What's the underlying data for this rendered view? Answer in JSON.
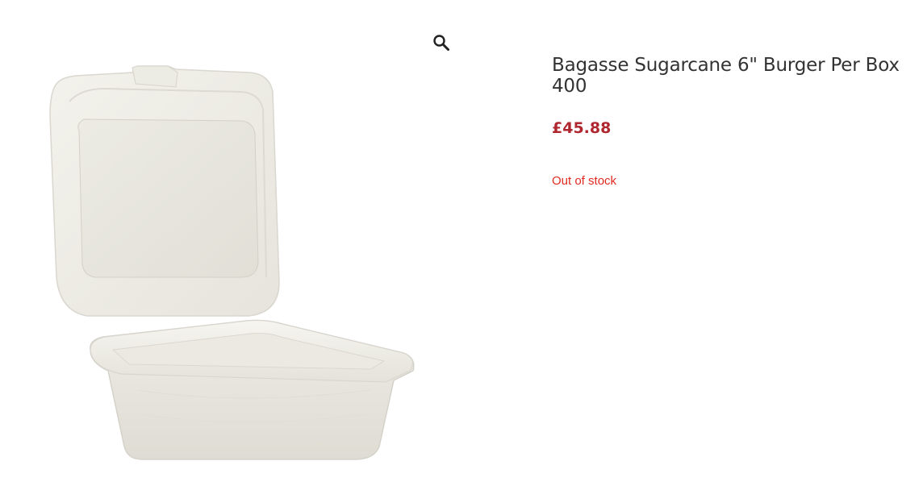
{
  "product": {
    "title": "Bagasse Sugarcane 6\" Burger Per Box 400",
    "price": "£45.88",
    "stock_status": "Out of stock",
    "image_alt": "Bagasse Sugarcane 6\" Burger Per Box 400"
  },
  "gallery": {
    "zoom_icon": "magnifier-icon"
  },
  "colors": {
    "price": "#b0262f",
    "stock_out": "#e02b20",
    "title": "#333333"
  }
}
